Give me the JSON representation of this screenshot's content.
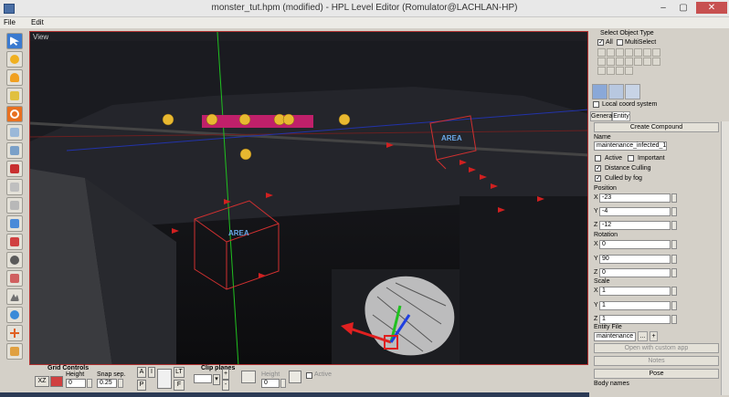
{
  "window": {
    "title": "monster_tut.hpm (modified) - HPL Level Editor  (Romulator@LACHLAN-HP)",
    "minimize": "–",
    "maximize": "▢",
    "close": "✕"
  },
  "menu": [
    "File",
    "Edit"
  ],
  "viewport": {
    "label": "View",
    "area_label_1": "AREA",
    "area_label_2": "AREA"
  },
  "bottom": {
    "grid_controls": "Grid Controls",
    "height_label": "Height",
    "snap_label": "Snap sep.",
    "xz_button": "XZ",
    "height_value": "0",
    "snap_value": "0.25",
    "a_button": "A",
    "p_button": "P",
    "i_button": "I",
    "lt_button": "LT",
    "f_button": "F",
    "clip_planes": "Clip planes",
    "clip_height_label": "Height",
    "clip_height_value": "0",
    "active_label": "Active",
    "plus": "+",
    "minus": "-"
  },
  "right": {
    "select_object_type": "Select Object Type",
    "all_label": "All",
    "multiselect_label": "MultiSelect",
    "local_coord": "Local coord system",
    "tab_general": "General",
    "tab_entity": "Entity",
    "create_compound": "Create Compound",
    "name_label": "Name",
    "name_value": "maintenance_infected_1",
    "active_label": "Active",
    "important_label": "Important",
    "distance_culling": "Distance Culling",
    "culled_by_fog": "Culled by fog",
    "position_label": "Position",
    "pos_x": "-23",
    "pos_y": "-4",
    "pos_z": "-12",
    "rotation_label": "Rotation",
    "rot_x": "0",
    "rot_y": "90",
    "rot_z": "0",
    "scale_label": "Scale",
    "scale_x": "1",
    "scale_y": "1",
    "scale_z": "1",
    "x": "X",
    "y": "Y",
    "z": "Z",
    "entity_file_label": "Entity File",
    "entity_file_value": "maintenance",
    "browse": "...",
    "add": "+",
    "open_custom_app": "Open with custom app",
    "notes": "Notes",
    "pose": "Pose",
    "body_names": "Body names"
  },
  "colors": {
    "viewport_border": "#b03030",
    "area_box": "#d03030",
    "area_text": "#6aa8e8",
    "light_bulb": "#e8b830",
    "billboard": "#c0206a",
    "axis_x": "#e02020",
    "axis_y": "#20c020",
    "axis_z": "#2040e0"
  }
}
